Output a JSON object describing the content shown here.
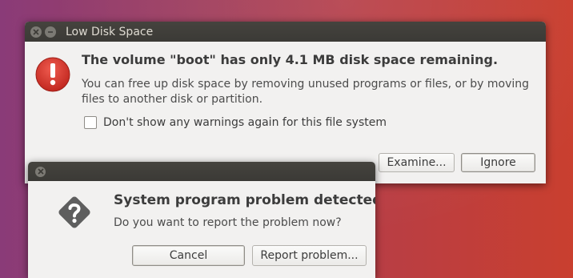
{
  "low_disk": {
    "title": "Low Disk Space",
    "heading": "The volume \"boot\" has only 4.1 MB disk space remaining.",
    "message_line1": "You can free up disk space by removing unused programs or files, or by moving",
    "message_line2": "files to another disk or partition.",
    "checkbox_label": "Don't show any warnings again for this file system",
    "checkbox_checked": false,
    "examine_label": "Examine...",
    "ignore_label": "Ignore",
    "icon": "error-icon"
  },
  "problem": {
    "heading": "System program problem detected",
    "message": "Do you want to report the problem now?",
    "cancel_label": "Cancel",
    "report_label": "Report problem...",
    "icon": "question-icon"
  },
  "colors": {
    "titlebar": "#3c3b37",
    "error_icon": "#d13228",
    "question_icon": "#5e5e5e"
  }
}
